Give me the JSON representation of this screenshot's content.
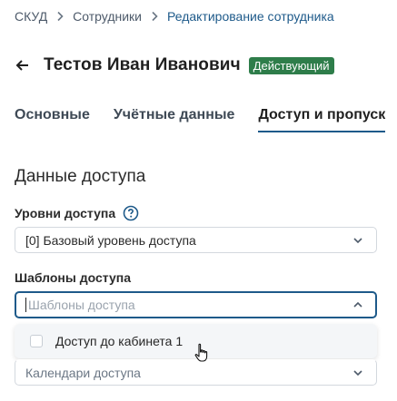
{
  "breadcrumb": {
    "items": [
      "СКУД",
      "Сотрудники",
      "Редактирование сотрудника"
    ]
  },
  "header": {
    "title": "Тестов Иван Иванович",
    "status": "Действующий",
    "status_color": "#2e7d4a"
  },
  "tabs": [
    {
      "label": "Основные",
      "active": false
    },
    {
      "label": "Учётные данные",
      "active": false
    },
    {
      "label": "Доступ и пропуск",
      "active": true
    }
  ],
  "section": {
    "title": "Данные доступа"
  },
  "fields": {
    "access_levels": {
      "label": "Уровни доступа",
      "value": "[0] Базовый уровень доступа"
    },
    "access_templates": {
      "label": "Шаблоны доступа",
      "placeholder": "Шаблоны доступа",
      "options": [
        {
          "label": "Доступ до кабинета 1",
          "checked": false
        }
      ]
    },
    "access_calendars": {
      "placeholder": "Календари доступа"
    }
  },
  "colors": {
    "accent": "#1e5a8a",
    "badge_bg": "#2e7d4a"
  }
}
